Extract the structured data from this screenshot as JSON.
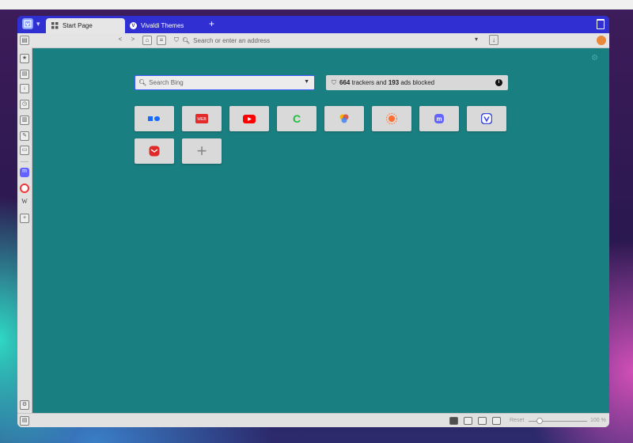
{
  "tabs": [
    {
      "label": "Start Page",
      "active": true,
      "icon": "grid-icon"
    },
    {
      "label": "Vivaldi Themes",
      "active": false,
      "icon": "vivaldi-icon"
    }
  ],
  "new_tab_symbol": "+",
  "address": {
    "placeholder": "Search or enter an address"
  },
  "search": {
    "placeholder": "Search Bing",
    "engine": "Bing"
  },
  "tracker": {
    "trackers": "664",
    "text_mid": " trackers and ",
    "ads": "193",
    "text_end": " ads blocked"
  },
  "speed_dials": [
    {
      "name": "behance",
      "color": "#1769ff"
    },
    {
      "name": "web-dot-de",
      "color": "#e32b2b"
    },
    {
      "name": "youtube",
      "color": "#ff0000"
    },
    {
      "name": "c-site",
      "color": "#1fbf3e"
    },
    {
      "name": "colorful-app",
      "color": "#f4b400"
    },
    {
      "name": "sunburst-site",
      "color": "#ff6d2d"
    },
    {
      "name": "mastodon",
      "color": "#6364ff"
    },
    {
      "name": "vivaldi",
      "color": "#3b4bd6"
    },
    {
      "name": "vivaldi-mail",
      "color": "#e02a2a"
    }
  ],
  "add_dial_symbol": "+",
  "statusbar": {
    "reset_label": "Reset",
    "zoom": "100 %"
  },
  "colors": {
    "tabbar": "#2f2fd2",
    "page_bg": "#1a7f80",
    "accent": "#3d5bff"
  }
}
